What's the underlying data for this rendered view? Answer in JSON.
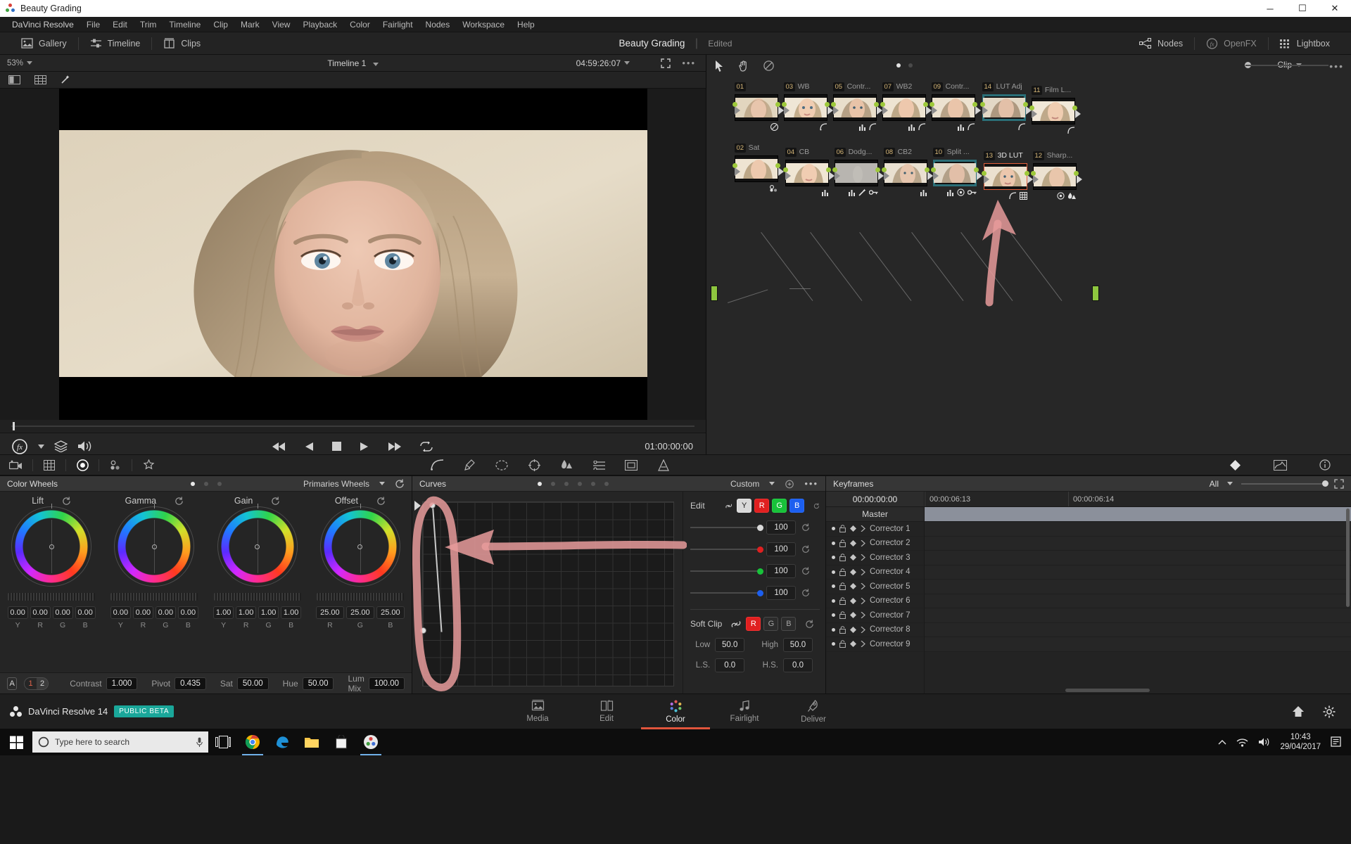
{
  "window": {
    "title": "Beauty Grading",
    "controls": {
      "minimize": "─",
      "maximize": "☐",
      "close": "✕"
    }
  },
  "menubar": [
    "DaVinci Resolve",
    "File",
    "Edit",
    "Trim",
    "Timeline",
    "Clip",
    "Mark",
    "View",
    "Playback",
    "Color",
    "Fairlight",
    "Nodes",
    "Workspace",
    "Help"
  ],
  "toolbar": {
    "left": [
      {
        "label": "Gallery",
        "icon": "gallery-icon"
      },
      {
        "label": "Timeline",
        "icon": "timeline-icon"
      },
      {
        "label": "Clips",
        "icon": "clips-icon"
      }
    ],
    "project_title": "Beauty Grading",
    "separator": "|",
    "status": "Edited",
    "right": [
      {
        "label": "Nodes",
        "icon": "nodes-icon"
      },
      {
        "label": "OpenFX",
        "icon": "openfx-icon"
      },
      {
        "label": "Lightbox",
        "icon": "lightbox-icon"
      }
    ]
  },
  "viewer": {
    "zoom": "53%",
    "timeline_name": "Timeline 1",
    "timecode": "04:59:26:07",
    "current_timecode": "01:00:00:00"
  },
  "node_editor": {
    "clip_label": "Clip",
    "nodes": [
      {
        "num": "01",
        "label": "",
        "row": "top",
        "col": 0,
        "icons": [
          "power-icon"
        ]
      },
      {
        "num": "02",
        "label": "Sat",
        "row": "bottom",
        "col": 0,
        "icons": [
          "keyer-icon"
        ]
      },
      {
        "num": "03",
        "label": "WB",
        "row": "top",
        "col": 1,
        "icons": [
          "curve-icon"
        ]
      },
      {
        "num": "04",
        "label": "CB",
        "row": "bottom",
        "col": 1,
        "icons": [
          "bars-icon"
        ]
      },
      {
        "num": "05",
        "label": "Contr...",
        "row": "top",
        "col": 2,
        "icons": [
          "bars-icon",
          "curve-icon"
        ]
      },
      {
        "num": "06",
        "label": "Dodg...",
        "row": "bottom",
        "col": 2,
        "icons": [
          "bars-icon",
          "wand-icon",
          "key-icon"
        ]
      },
      {
        "num": "07",
        "label": "WB2",
        "row": "top",
        "col": 3,
        "icons": [
          "bars-icon",
          "curve-icon"
        ]
      },
      {
        "num": "08",
        "label": "CB2",
        "row": "bottom",
        "col": 3,
        "icons": [
          "bars-icon"
        ]
      },
      {
        "num": "09",
        "label": "Contr...",
        "row": "top",
        "col": 4,
        "icons": [
          "bars-icon",
          "curve-icon"
        ]
      },
      {
        "num": "10",
        "label": "Split ...",
        "row": "bottom",
        "col": 4,
        "icons": [
          "bars-icon",
          "circle-icon",
          "key-icon"
        ]
      },
      {
        "num": "14",
        "label": "LUT Adj",
        "row": "top",
        "col": 5,
        "icons": [
          "curve-icon"
        ]
      },
      {
        "num": "13",
        "label": "3D LUT",
        "row": "bottom",
        "col": 5,
        "icons": [
          "curve-icon",
          "grid-icon"
        ],
        "selected": true
      },
      {
        "num": "11",
        "label": "Film L...",
        "row": "top",
        "col": 6,
        "icons": [
          "curve-icon"
        ]
      },
      {
        "num": "12",
        "label": "Sharp...",
        "row": "bottom",
        "col": 6,
        "icons": [
          "circle-icon",
          "drop-icon"
        ]
      }
    ]
  },
  "color_wheels": {
    "panel_title": "Color Wheels",
    "mode": "Primaries Wheels",
    "wheels": [
      {
        "name": "Lift",
        "values": [
          "0.00",
          "0.00",
          "0.00",
          "0.00"
        ],
        "labels": [
          "Y",
          "R",
          "G",
          "B"
        ]
      },
      {
        "name": "Gamma",
        "values": [
          "0.00",
          "0.00",
          "0.00",
          "0.00"
        ],
        "labels": [
          "Y",
          "R",
          "G",
          "B"
        ]
      },
      {
        "name": "Gain",
        "values": [
          "1.00",
          "1.00",
          "1.00",
          "1.00"
        ],
        "labels": [
          "Y",
          "R",
          "G",
          "B"
        ]
      },
      {
        "name": "Offset",
        "values": [
          "25.00",
          "25.00",
          "25.00"
        ],
        "labels": [
          "R",
          "G",
          "B"
        ]
      }
    ],
    "footer": {
      "version_button": "A",
      "ab_toggle": [
        "1",
        "2"
      ],
      "params": [
        {
          "key": "Contrast",
          "value": "1.000"
        },
        {
          "key": "Pivot",
          "value": "0.435"
        },
        {
          "key": "Sat",
          "value": "50.00"
        },
        {
          "key": "Hue",
          "value": "50.00"
        },
        {
          "key": "Lum Mix",
          "value": "100.00"
        }
      ]
    }
  },
  "curves": {
    "panel_title": "Curves",
    "mode": "Custom",
    "edit_label": "Edit",
    "channels": [
      {
        "label": "Y",
        "active": true
      },
      {
        "label": "R",
        "active": true
      },
      {
        "label": "G",
        "active": true
      },
      {
        "label": "B",
        "active": true
      }
    ],
    "sliders": [
      {
        "channel": "Y",
        "value": "100",
        "color": "#d9d9d9"
      },
      {
        "channel": "R",
        "value": "100",
        "color": "#e02020"
      },
      {
        "channel": "G",
        "value": "100",
        "color": "#18c23a"
      },
      {
        "channel": "B",
        "value": "100",
        "color": "#1c5ff0"
      }
    ],
    "soft_clip": {
      "label": "Soft Clip",
      "channels": [
        {
          "label": "R",
          "active": true
        },
        {
          "label": "G",
          "active": false
        },
        {
          "label": "B",
          "active": false
        }
      ],
      "fields": [
        {
          "label": "Low",
          "value": "50.0"
        },
        {
          "label": "High",
          "value": "50.0"
        },
        {
          "label": "L.S.",
          "value": "0.0"
        },
        {
          "label": "H.S.",
          "value": "0.0"
        }
      ]
    }
  },
  "keyframes": {
    "panel_title": "Keyframes",
    "filter": "All",
    "start_timecode": "00:00:00:00",
    "ruler": [
      "00:00:06:13",
      "00:00:06:14"
    ],
    "master_label": "Master",
    "rows": [
      "Corrector 1",
      "Corrector 2",
      "Corrector 3",
      "Corrector 4",
      "Corrector 5",
      "Corrector 6",
      "Corrector 7",
      "Corrector 8",
      "Corrector 9"
    ]
  },
  "statusbar": {
    "app_name": "DaVinci Resolve 14",
    "badge": "PUBLIC BETA",
    "pages": [
      {
        "label": "Media",
        "icon": "media-icon",
        "active": false
      },
      {
        "label": "Edit",
        "icon": "edit-icon",
        "active": false
      },
      {
        "label": "Color",
        "icon": "color-icon",
        "active": true
      },
      {
        "label": "Fairlight",
        "icon": "fairlight-icon",
        "active": false
      },
      {
        "label": "Deliver",
        "icon": "deliver-icon",
        "active": false
      }
    ],
    "right_icons": [
      "home-icon",
      "gear-icon"
    ]
  },
  "taskbar": {
    "search_placeholder": "Type here to search",
    "apps": [
      "task-view-icon",
      "chrome-icon",
      "edge-icon",
      "file-explorer-icon",
      "store-icon",
      "resolve-icon"
    ],
    "tray": {
      "time": "10:43",
      "date": "29/04/2017"
    }
  },
  "colors": {
    "accent_red": "#e0553c",
    "node_selected": "#e2603c",
    "port_green": "#9ec93a",
    "beta_teal": "#1aa79a",
    "annotation_pink": "#e79b9b"
  }
}
